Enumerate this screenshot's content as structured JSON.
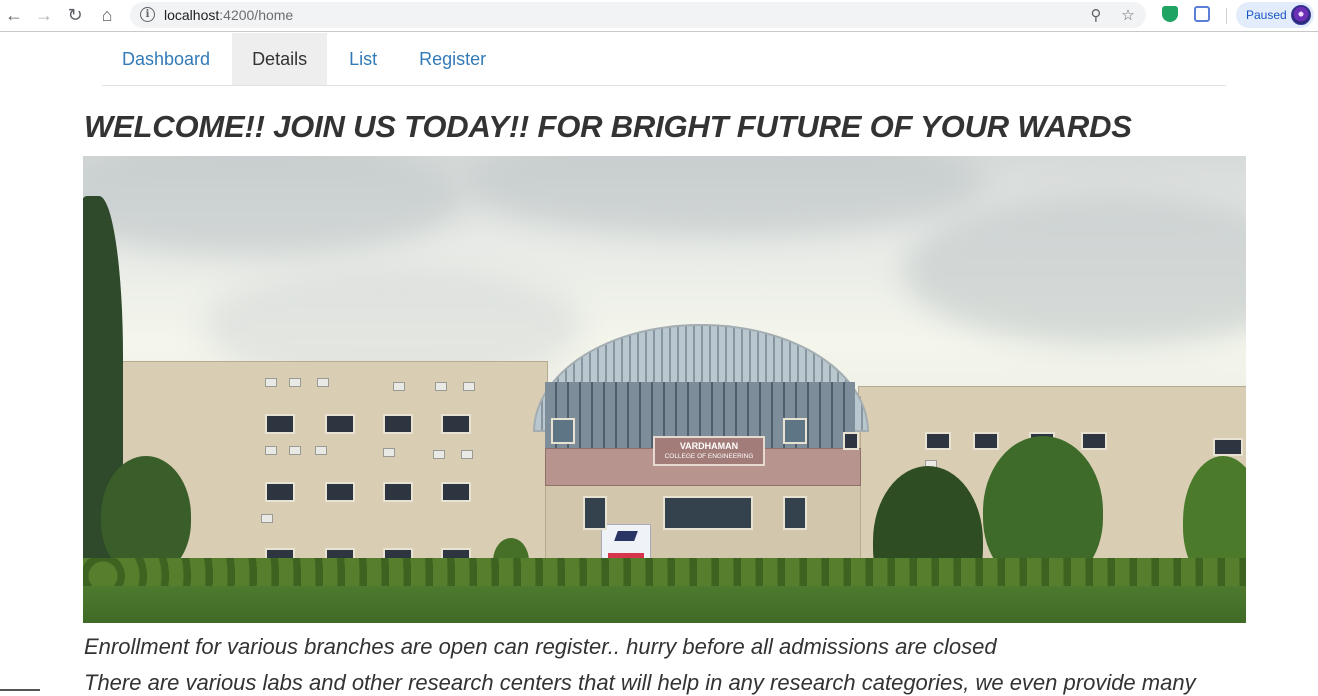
{
  "browser": {
    "url_host": "localhost",
    "url_path": ":4200/home",
    "profile_status": "Paused",
    "icons": {
      "back": "back-arrow-icon",
      "forward": "forward-arrow-icon",
      "reload": "reload-icon",
      "home": "home-icon",
      "site_info": "info-icon",
      "zoom": "zoom-icon",
      "bookmark": "star-icon",
      "extension_1": "shield-extension-icon",
      "extension_2": "extension-icon",
      "avatar": "profile-avatar-icon"
    }
  },
  "nav": {
    "tabs": [
      {
        "label": "Dashboard",
        "active": false
      },
      {
        "label": "Details",
        "active": true
      },
      {
        "label": "List",
        "active": false
      },
      {
        "label": "Register",
        "active": false
      }
    ]
  },
  "main": {
    "headline": "WELCOME!! JOIN US TODAY!! FOR BRIGHT FUTURE OF YOUR WARDS",
    "hero_sign_title": "VARDHAMAN",
    "hero_sign_subtitle": "COLLEGE OF ENGINEERING",
    "paragraph_1": "Enrollment for various branches are open can register.. hurry before all admissions are closed",
    "paragraph_2": "There are various labs and other research centers that will help in any research categories, we even provide many"
  },
  "colors": {
    "link": "#337ab7",
    "active_tab_bg": "#eeeeee",
    "text": "#333333",
    "paused_pill_bg": "#e3ecfb"
  }
}
